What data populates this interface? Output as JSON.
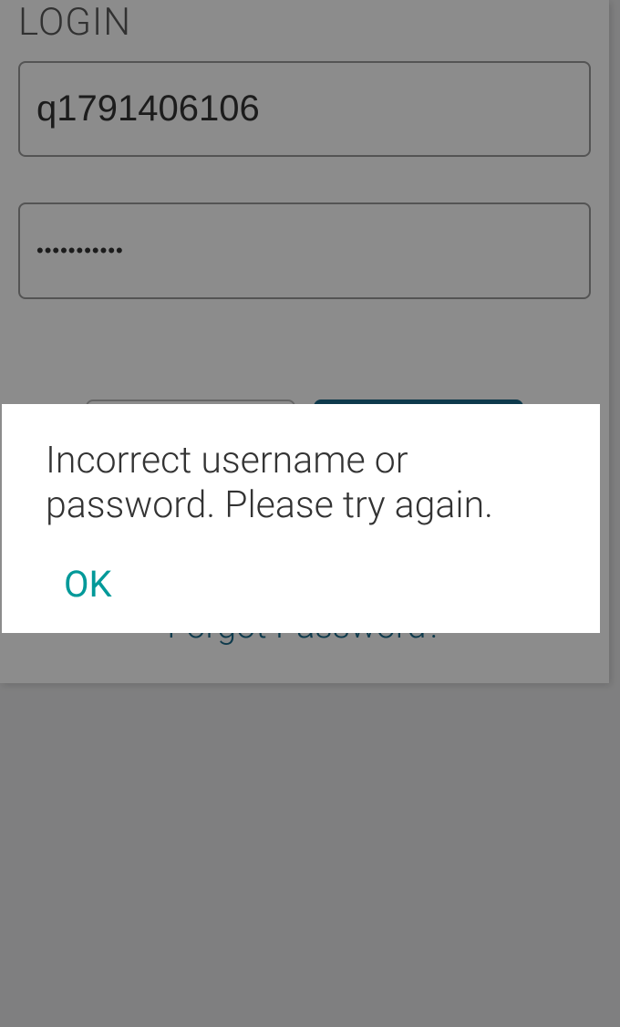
{
  "login": {
    "title": "LOGIN",
    "username_value": "q1791406106",
    "password_value": "•••••••••••",
    "button_secondary_label": "",
    "button_primary_label": "",
    "forgot_label": "Forgot Password?"
  },
  "modal": {
    "message": "Incorrect username or password. Please try again.",
    "ok_label": "OK"
  }
}
